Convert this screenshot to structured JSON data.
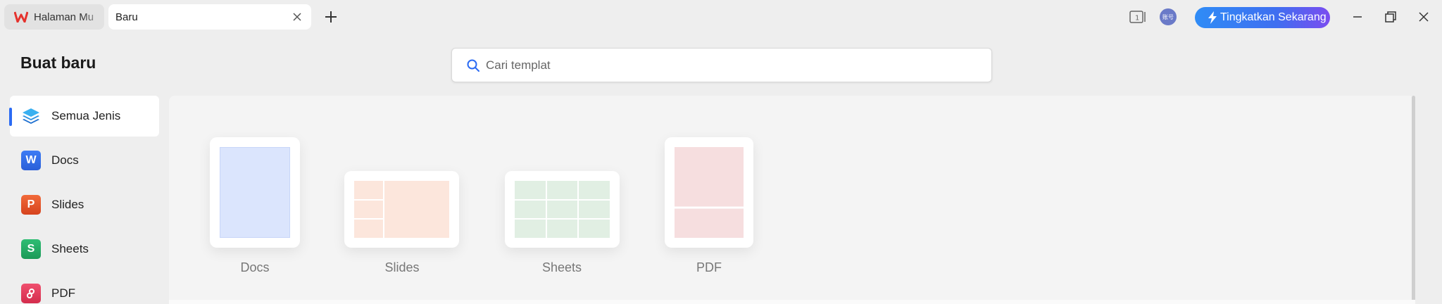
{
  "tabs": {
    "home_label": "Halaman Mu",
    "active_label": "Baru"
  },
  "toolbar": {
    "avatar_text": "账号",
    "upgrade_label": "Tingkatkan Sekarang"
  },
  "header": {
    "title": "Buat baru",
    "search_placeholder": "Cari templat"
  },
  "nav": {
    "items": [
      {
        "label": "Semua Jenis",
        "icon": "layers-icon",
        "active": true
      },
      {
        "label": "Docs",
        "icon": "docs-app-icon",
        "glyph": "W"
      },
      {
        "label": "Slides",
        "icon": "slides-app-icon",
        "glyph": "P"
      },
      {
        "label": "Sheets",
        "icon": "sheets-app-icon",
        "glyph": "S"
      },
      {
        "label": "PDF",
        "icon": "pdf-app-icon"
      }
    ]
  },
  "templates": [
    {
      "label": "Docs",
      "color": "#dbe5fd"
    },
    {
      "label": "Slides",
      "color": "#fce6dc"
    },
    {
      "label": "Sheets",
      "color": "#e1efe3"
    },
    {
      "label": "PDF",
      "color": "#f6dedf"
    }
  ],
  "colors": {
    "accent": "#2b6bf3",
    "upgrade_start": "#2f8cf6",
    "upgrade_end": "#7b4cf0",
    "wps_red": "#e5322d"
  }
}
